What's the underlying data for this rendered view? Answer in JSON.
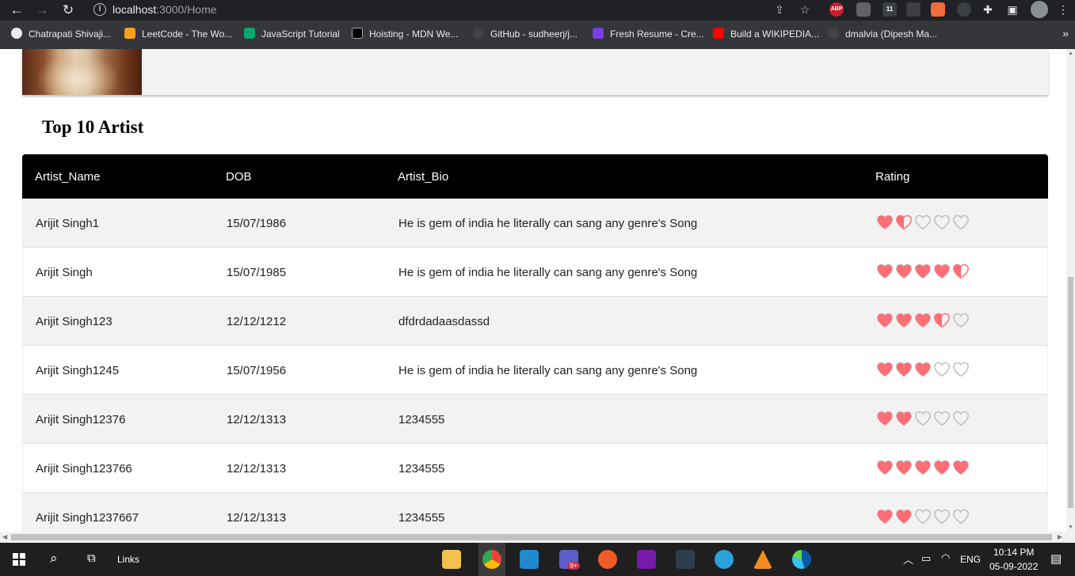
{
  "browser": {
    "url_host": "localhost",
    "url_path": ":3000/Home",
    "ext_abp": "ABP",
    "ext_badge": "11"
  },
  "bookmarks": [
    {
      "label": "Chatrapati Shivaji...",
      "color": "#e8eaed"
    },
    {
      "label": "LeetCode - The Wo...",
      "color": "#f89f1b"
    },
    {
      "label": "JavaScript Tutorial",
      "color": "#04aa6d"
    },
    {
      "label": "Hoisting - MDN We...",
      "color": "#000000"
    },
    {
      "label": "GitHub - sudheerj/j...",
      "color": "#444444"
    },
    {
      "label": "Fresh Resume - Cre...",
      "color": "#7b3fe4"
    },
    {
      "label": "Build a WIKIPEDIA...",
      "color": "#ff0000"
    },
    {
      "label": "dmalvia (Dipesh Ma...",
      "color": "#444444"
    }
  ],
  "bookmarks_more": "»",
  "main": {
    "section_title": "Top 10 Artist",
    "columns": [
      "Artist_Name",
      "DOB",
      "Artist_Bio",
      "Rating"
    ],
    "rows": [
      {
        "name": "Arijit Singh1",
        "dob": "15/07/1986",
        "bio": "He is gem of india he literally can sang any genre's Song",
        "rating": 1.5
      },
      {
        "name": "Arijit Singh",
        "dob": "15/07/1985",
        "bio": "He is gem of india he literally can sang any genre's Song",
        "rating": 4.5
      },
      {
        "name": "Arijit Singh123",
        "dob": "12/12/1212",
        "bio": "dfdrdadaasdassd",
        "rating": 3.5
      },
      {
        "name": "Arijit Singh1245",
        "dob": "15/07/1956",
        "bio": "He is gem of india he literally can sang any genre's Song",
        "rating": 3
      },
      {
        "name": "Arijit Singh12376",
        "dob": "12/12/1313",
        "bio": "1234555",
        "rating": 2
      },
      {
        "name": "Arijit Singh123766",
        "dob": "12/12/1313",
        "bio": "1234555",
        "rating": 5
      },
      {
        "name": "Arijit Singh1237667",
        "dob": "12/12/1313",
        "bio": "1234555",
        "rating": 2
      }
    ],
    "rating_max": 5,
    "heart_filled_color": "#ff6d75",
    "heart_empty_color": "#bdbdbd"
  },
  "taskbar": {
    "search_label": "Links",
    "lang": "ENG",
    "time": "10:14 PM",
    "date": "05-09-2022",
    "teams_badge": "9+"
  }
}
